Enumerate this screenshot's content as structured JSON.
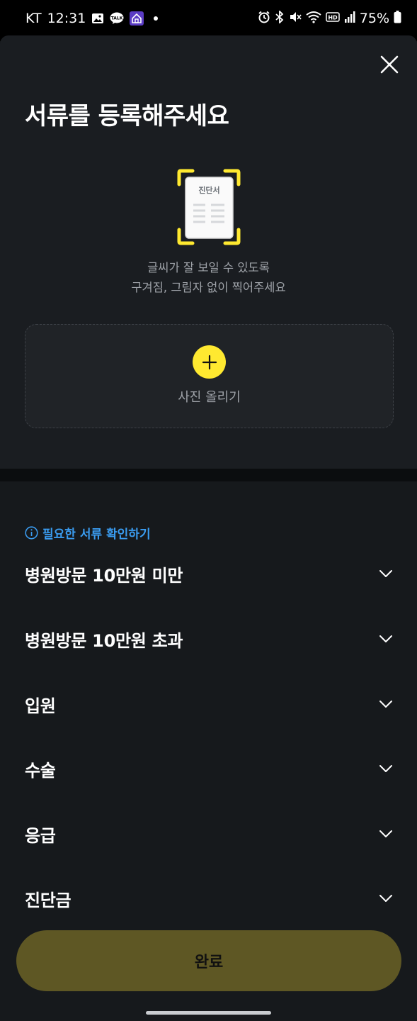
{
  "status_bar": {
    "carrier": "KT",
    "time": "12:31",
    "left_icons": [
      "gallery-icon",
      "talk-icon",
      "home-app-icon"
    ],
    "talk_label": "TALK",
    "right_icons": [
      "alarm-icon",
      "bluetooth-icon",
      "mute-icon",
      "wifi-icon",
      "hd-icon",
      "signal-icon"
    ],
    "hd_label": "HD",
    "battery": "75%"
  },
  "header": {
    "title": "서류를 등록해주세요"
  },
  "illustration": {
    "doc_label": "진단서",
    "accent_color": "#ffe930"
  },
  "hint": {
    "line1": "글씨가 잘 보일 수 있도록",
    "line2": "구겨짐, 그림자 없이 찍어주세요"
  },
  "upload": {
    "label": "사진 올리기"
  },
  "info_link": {
    "label": "필요한 서류 확인하기",
    "color": "#3a9cf0"
  },
  "categories": [
    {
      "label": "병원방문 10만원 미만"
    },
    {
      "label": "병원방문 10만원 초과"
    },
    {
      "label": "입원"
    },
    {
      "label": "수술"
    },
    {
      "label": "응급"
    },
    {
      "label": "진단금"
    }
  ],
  "footer": {
    "done_label": "완료",
    "done_color": "#5e5724"
  }
}
